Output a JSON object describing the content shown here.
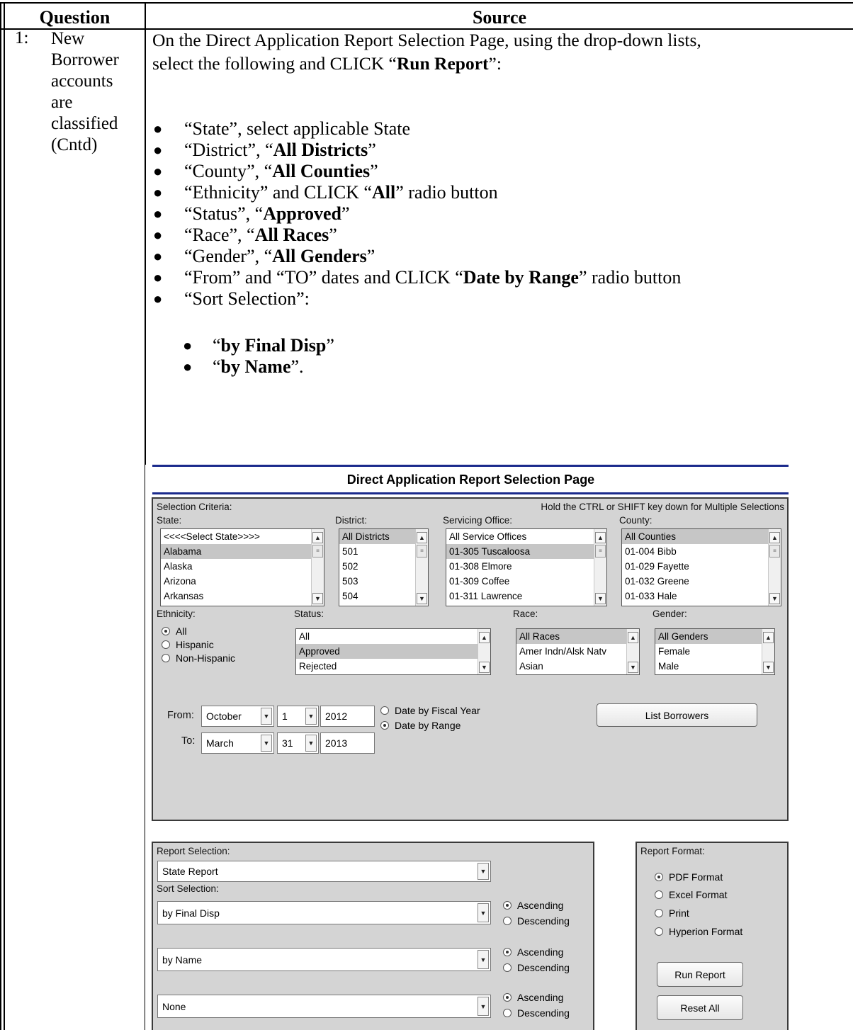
{
  "table": {
    "col_question": "Question",
    "col_source": "Source",
    "row_number": "1:",
    "question_lines": [
      "New",
      "Borrower",
      "accounts",
      "are",
      "classified",
      "(Cntd)"
    ],
    "intro_line1": "On the Direct Application Report Selection Page, using the drop-down lists,",
    "intro_line2_pre": "select the following and CLICK “",
    "intro_line2_bold": "Run Report",
    "intro_line2_post": "”:",
    "bullets": [
      {
        "pre": "“State”, select applicable State",
        "bold": "",
        "post": ""
      },
      {
        "pre": "“District”, “",
        "bold": "All Districts",
        "post": "”"
      },
      {
        "pre": "“County”, “",
        "bold": "All Counties",
        "post": "”"
      },
      {
        "pre": "“Ethnicity” and CLICK “",
        "bold": "All",
        "post": "” radio button"
      },
      {
        "pre": "“Status”, “",
        "bold": "Approved",
        "post": "”"
      },
      {
        "pre": "“Race”, “",
        "bold": "All Races",
        "post": "”"
      },
      {
        "pre": "“Gender”, “",
        "bold": "All Genders",
        "post": "”"
      },
      {
        "pre": "“From” and “TO” dates and CLICK “",
        "bold": "Date by Range",
        "post": "” radio button"
      },
      {
        "pre": "“Sort Selection”:",
        "bold": "",
        "post": ""
      }
    ],
    "sub_bullets": [
      {
        "pre": "“",
        "bold": "by Final Disp",
        "post": "”"
      },
      {
        "pre": "“",
        "bold": "by Name",
        "post": "”."
      }
    ]
  },
  "screen": {
    "title": "Direct Application Report Selection Page",
    "selection_criteria_label": "Selection Criteria:",
    "multi_hint": "Hold the CTRL or SHIFT key down for Multiple Selections",
    "state": {
      "label": "State:",
      "options": [
        "<<<<Select State>>>>",
        "Alabama",
        "Alaska",
        "Arizona",
        "Arkansas"
      ],
      "selected_index": 1
    },
    "district": {
      "label": "District:",
      "options": [
        "All Districts",
        "501",
        "502",
        "503",
        "504"
      ],
      "selected_index": 0
    },
    "servicing_office": {
      "label": "Servicing Office:",
      "options": [
        "All Service Offices",
        "01-305 Tuscaloosa",
        "01-308 Elmore",
        "01-309 Coffee",
        "01-311 Lawrence"
      ],
      "selected_index": 1
    },
    "county": {
      "label": "County:",
      "options": [
        "All Counties",
        "01-004 Bibb",
        "01-029 Fayette",
        "01-032 Greene",
        "01-033 Hale"
      ],
      "selected_index": 0
    },
    "ethnicity": {
      "label": "Ethnicity:",
      "options": [
        "All",
        "Hispanic",
        "Non-Hispanic"
      ],
      "selected_index": 0
    },
    "status": {
      "label": "Status:",
      "options": [
        "All",
        "Approved",
        "Rejected"
      ],
      "selected_index": 1
    },
    "race": {
      "label": "Race:",
      "options": [
        "All Races",
        "Amer Indn/Alsk Natv",
        "Asian"
      ],
      "selected_index": 0
    },
    "gender": {
      "label": "Gender:",
      "options": [
        "All Genders",
        "Female",
        "Male"
      ],
      "selected_index": 0
    },
    "from": {
      "label": "From:",
      "month": "October",
      "day": "1",
      "year": "2012"
    },
    "to": {
      "label": "To:",
      "month": "March",
      "day": "31",
      "year": "2013"
    },
    "date_mode": {
      "options": [
        "Date by Fiscal Year",
        "Date by Range"
      ],
      "selected_index": 1
    },
    "list_borrowers_label": "List Borrowers",
    "report_selection_label": "Report Selection:",
    "report_selection_value": "State Report",
    "sort_selection_label": "Sort Selection:",
    "sorts": [
      {
        "value": "by Final Disp",
        "asc": "Ascending",
        "desc": "Descending",
        "selected": "asc"
      },
      {
        "value": "by Name",
        "asc": "Ascending",
        "desc": "Descending",
        "selected": "asc"
      },
      {
        "value": "None",
        "asc": "Ascending",
        "desc": "Descending",
        "selected": "asc"
      }
    ],
    "report_format": {
      "label": "Report Format:",
      "options": [
        "PDF Format",
        "Excel Format",
        "Print",
        "Hyperion Format"
      ],
      "selected_index": 0
    },
    "run_report_label": "Run Report",
    "reset_all_label": "Reset All"
  }
}
